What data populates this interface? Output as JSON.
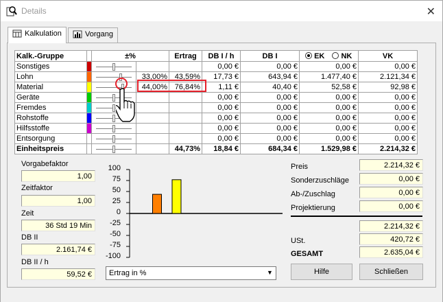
{
  "window": {
    "title": "Details"
  },
  "tabs": [
    {
      "label": "Kalkulation",
      "active": true
    },
    {
      "label": "Vorgang",
      "active": false
    }
  ],
  "grid": {
    "headers": {
      "group": "Kalk.-Gruppe",
      "pct": "±%",
      "ertrag": "Ertrag",
      "dbih": "DB I / h",
      "dbi": "DB I",
      "ek": "EK",
      "nk": "NK",
      "vk": "VK"
    },
    "mode_selected": "EK",
    "rows": [
      {
        "name": "Sonstiges",
        "color": "#cc0000",
        "pct": "",
        "ertrag": "",
        "dbih": "0,00 €",
        "dbi": "0,00 €",
        "eknk": "0,00 €",
        "vk": "0,00 €",
        "slider": 0.5
      },
      {
        "name": "Lohn",
        "color": "#ff6600",
        "pct": "33,00%",
        "ertrag": "43,59%",
        "dbih": "17,73 €",
        "dbi": "643,94 €",
        "eknk": "1.477,40 €",
        "vk": "2.121,34 €",
        "slider": 0.66
      },
      {
        "name": "Material",
        "color": "#ffff00",
        "pct": "44,00%",
        "ertrag": "76,84%",
        "dbih": "1,11 €",
        "dbi": "40,40 €",
        "eknk": "52,58 €",
        "vk": "92,98 €",
        "slider": 0.7
      },
      {
        "name": "Geräte",
        "color": "#00cc00",
        "pct": "",
        "ertrag": "",
        "dbih": "0,00 €",
        "dbi": "0,00 €",
        "eknk": "0,00 €",
        "vk": "0,00 €",
        "slider": 0.5
      },
      {
        "name": "Fremdes",
        "color": "#00cccc",
        "pct": "",
        "ertrag": "",
        "dbih": "0,00 €",
        "dbi": "0,00 €",
        "eknk": "0,00 €",
        "vk": "0,00 €",
        "slider": 0.5
      },
      {
        "name": "Rohstoffe",
        "color": "#0000ff",
        "pct": "",
        "ertrag": "",
        "dbih": "0,00 €",
        "dbi": "0,00 €",
        "eknk": "0,00 €",
        "vk": "0,00 €",
        "slider": 0.5
      },
      {
        "name": "Hilfsstoffe",
        "color": "#cc00cc",
        "pct": "",
        "ertrag": "",
        "dbih": "0,00 €",
        "dbi": "0,00 €",
        "eknk": "0,00 €",
        "vk": "0,00 €",
        "slider": 0.5
      },
      {
        "name": "Entsorgung",
        "color": "#ffffff",
        "pct": "",
        "ertrag": "",
        "dbih": "0,00 €",
        "dbi": "0,00 €",
        "eknk": "0,00 €",
        "vk": "0,00 €",
        "slider": 0.5
      }
    ],
    "total": {
      "name": "Einheitspreis",
      "pct": "",
      "ertrag": "44,73%",
      "dbih": "18,84 €",
      "dbi": "684,34 €",
      "eknk": "1.529,98 €",
      "vk": "2.214,32 €",
      "slider": 0.5
    }
  },
  "left_fields": {
    "vorgabefaktor": {
      "label": "Vorgabefaktor",
      "value": "1,00"
    },
    "zeitfaktor": {
      "label": "Zeitfaktor",
      "value": "1,00"
    },
    "zeit": {
      "label": "Zeit",
      "value": "36 Std 19 Min"
    },
    "db2": {
      "label": "DB II",
      "value": "2.161,74 €"
    },
    "db2h": {
      "label": "DB II / h",
      "value": "59,52 €"
    }
  },
  "chart_data": {
    "type": "bar",
    "categories": [
      "Sonstiges",
      "Lohn",
      "Material",
      "Geräte",
      "Fremdes",
      "Rohstoffe",
      "Hilfsstoffe",
      "Entsorgung"
    ],
    "values": [
      0,
      43.59,
      76.84,
      0,
      0,
      0,
      0,
      0
    ],
    "colors": [
      "#cc0000",
      "#ff7f00",
      "#ffff00",
      "#00cc00",
      "#00cccc",
      "#0000ff",
      "#cc00cc",
      "#ffffff"
    ],
    "yticks": [
      "100",
      "75",
      "50",
      "25",
      "0",
      "-25",
      "-50",
      "-75",
      "-100"
    ],
    "ylim": [
      -100,
      100
    ]
  },
  "chart_select": {
    "value": "Ertrag in %"
  },
  "right_fields": {
    "preis": {
      "label": "Preis",
      "value": "2.214,32 €"
    },
    "sonder": {
      "label": "Sonderzuschläge",
      "value": "0,00 €"
    },
    "abzu": {
      "label": "Ab-/Zuschlag",
      "value": "0,00 €"
    },
    "proj": {
      "label": "Projektierung",
      "value": "0,00 €"
    },
    "sub": {
      "value": "2.214,32 €"
    },
    "ust": {
      "label": "USt.",
      "value": "420,72 €"
    },
    "gesamt": {
      "label": "GESAMT",
      "value": "2.635,04 €"
    }
  },
  "buttons": {
    "hilfe": "Hilfe",
    "schliessen": "Schließen"
  }
}
